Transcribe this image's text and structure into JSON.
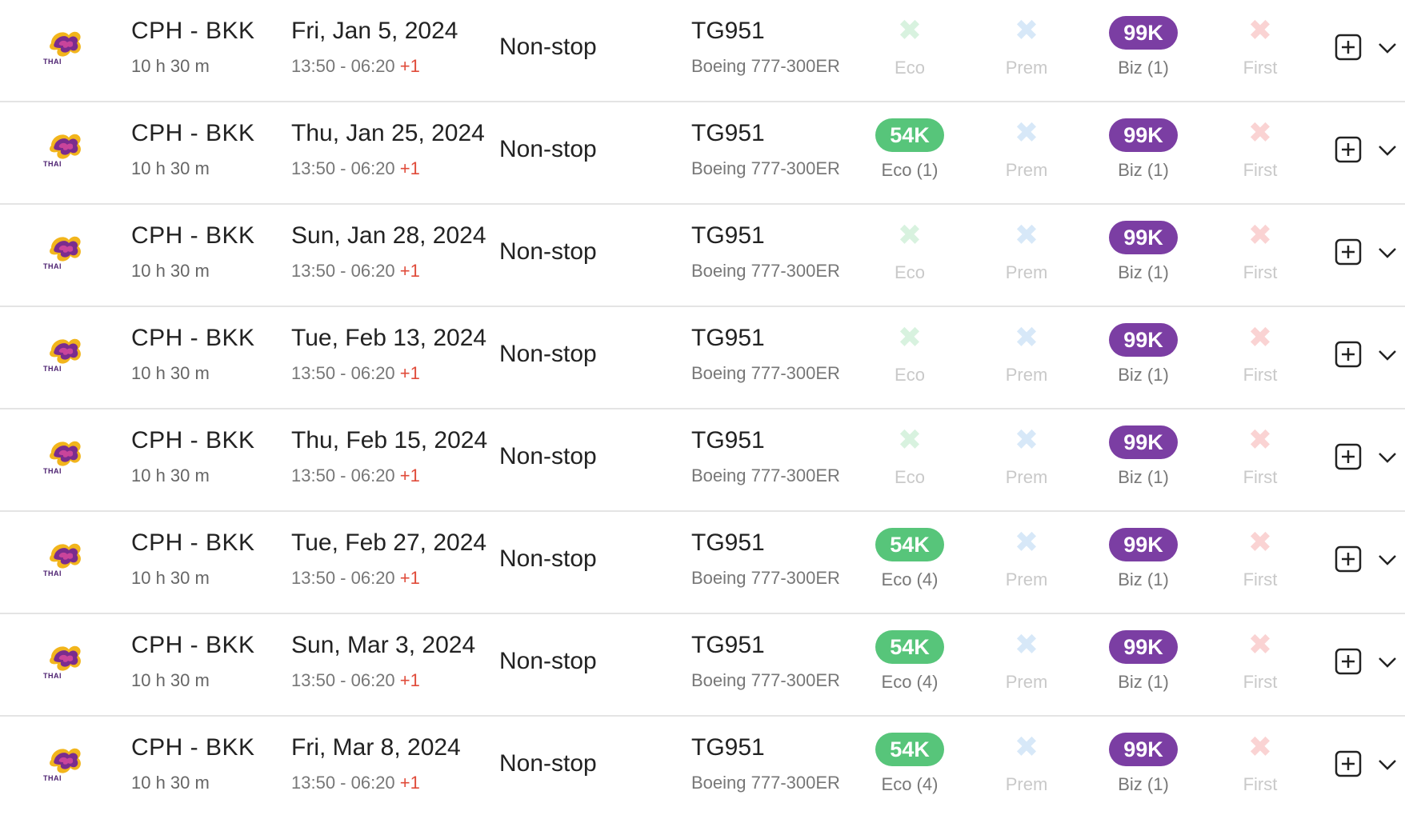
{
  "flights": [
    {
      "airline_logo_text": "THAI",
      "route": "CPH - BKK",
      "duration": "10 h 30 m",
      "date": "Fri, Jan 5, 2024",
      "times": "13:50 - 06:20",
      "day_offset": "+1",
      "stops": "Non-stop",
      "flight_number": "TG951",
      "aircraft": "Boeing 777-300ER",
      "fares": {
        "eco": {
          "available": false,
          "price": "",
          "label": "Eco"
        },
        "prem": {
          "available": false,
          "price": "",
          "label": "Prem"
        },
        "biz": {
          "available": true,
          "price": "99K",
          "label": "Biz (1)"
        },
        "first": {
          "available": false,
          "price": "",
          "label": "First"
        }
      }
    },
    {
      "airline_logo_text": "THAI",
      "route": "CPH - BKK",
      "duration": "10 h 30 m",
      "date": "Thu, Jan 25, 2024",
      "times": "13:50 - 06:20",
      "day_offset": "+1",
      "stops": "Non-stop",
      "flight_number": "TG951",
      "aircraft": "Boeing 777-300ER",
      "fares": {
        "eco": {
          "available": true,
          "price": "54K",
          "label": "Eco (1)"
        },
        "prem": {
          "available": false,
          "price": "",
          "label": "Prem"
        },
        "biz": {
          "available": true,
          "price": "99K",
          "label": "Biz (1)"
        },
        "first": {
          "available": false,
          "price": "",
          "label": "First"
        }
      }
    },
    {
      "airline_logo_text": "THAI",
      "route": "CPH - BKK",
      "duration": "10 h 30 m",
      "date": "Sun, Jan 28, 2024",
      "times": "13:50 - 06:20",
      "day_offset": "+1",
      "stops": "Non-stop",
      "flight_number": "TG951",
      "aircraft": "Boeing 777-300ER",
      "fares": {
        "eco": {
          "available": false,
          "price": "",
          "label": "Eco"
        },
        "prem": {
          "available": false,
          "price": "",
          "label": "Prem"
        },
        "biz": {
          "available": true,
          "price": "99K",
          "label": "Biz (1)"
        },
        "first": {
          "available": false,
          "price": "",
          "label": "First"
        }
      }
    },
    {
      "airline_logo_text": "THAI",
      "route": "CPH - BKK",
      "duration": "10 h 30 m",
      "date": "Tue, Feb 13, 2024",
      "times": "13:50 - 06:20",
      "day_offset": "+1",
      "stops": "Non-stop",
      "flight_number": "TG951",
      "aircraft": "Boeing 777-300ER",
      "fares": {
        "eco": {
          "available": false,
          "price": "",
          "label": "Eco"
        },
        "prem": {
          "available": false,
          "price": "",
          "label": "Prem"
        },
        "biz": {
          "available": true,
          "price": "99K",
          "label": "Biz (1)"
        },
        "first": {
          "available": false,
          "price": "",
          "label": "First"
        }
      }
    },
    {
      "airline_logo_text": "THAI",
      "route": "CPH - BKK",
      "duration": "10 h 30 m",
      "date": "Thu, Feb 15, 2024",
      "times": "13:50 - 06:20",
      "day_offset": "+1",
      "stops": "Non-stop",
      "flight_number": "TG951",
      "aircraft": "Boeing 777-300ER",
      "fares": {
        "eco": {
          "available": false,
          "price": "",
          "label": "Eco"
        },
        "prem": {
          "available": false,
          "price": "",
          "label": "Prem"
        },
        "biz": {
          "available": true,
          "price": "99K",
          "label": "Biz (1)"
        },
        "first": {
          "available": false,
          "price": "",
          "label": "First"
        }
      }
    },
    {
      "airline_logo_text": "THAI",
      "route": "CPH - BKK",
      "duration": "10 h 30 m",
      "date": "Tue, Feb 27, 2024",
      "times": "13:50 - 06:20",
      "day_offset": "+1",
      "stops": "Non-stop",
      "flight_number": "TG951",
      "aircraft": "Boeing 777-300ER",
      "fares": {
        "eco": {
          "available": true,
          "price": "54K",
          "label": "Eco (4)"
        },
        "prem": {
          "available": false,
          "price": "",
          "label": "Prem"
        },
        "biz": {
          "available": true,
          "price": "99K",
          "label": "Biz (1)"
        },
        "first": {
          "available": false,
          "price": "",
          "label": "First"
        }
      }
    },
    {
      "airline_logo_text": "THAI",
      "route": "CPH - BKK",
      "duration": "10 h 30 m",
      "date": "Sun, Mar 3, 2024",
      "times": "13:50 - 06:20",
      "day_offset": "+1",
      "stops": "Non-stop",
      "flight_number": "TG951",
      "aircraft": "Boeing 777-300ER",
      "fares": {
        "eco": {
          "available": true,
          "price": "54K",
          "label": "Eco (4)"
        },
        "prem": {
          "available": false,
          "price": "",
          "label": "Prem"
        },
        "biz": {
          "available": true,
          "price": "99K",
          "label": "Biz (1)"
        },
        "first": {
          "available": false,
          "price": "",
          "label": "First"
        }
      }
    },
    {
      "airline_logo_text": "THAI",
      "route": "CPH - BKK",
      "duration": "10 h 30 m",
      "date": "Fri, Mar 8, 2024",
      "times": "13:50 - 06:20",
      "day_offset": "+1",
      "stops": "Non-stop",
      "flight_number": "TG951",
      "aircraft": "Boeing 777-300ER",
      "fares": {
        "eco": {
          "available": true,
          "price": "54K",
          "label": "Eco (4)"
        },
        "prem": {
          "available": false,
          "price": "",
          "label": "Prem"
        },
        "biz": {
          "available": true,
          "price": "99K",
          "label": "Biz (1)"
        },
        "first": {
          "available": false,
          "price": "",
          "label": "First"
        }
      }
    }
  ],
  "icons": {
    "unavailable": "close-icon",
    "add": "plus-square-icon",
    "expand": "chevron-down-icon",
    "airline": "thai-airways-logo-icon"
  },
  "colors": {
    "eco_available": "#57c57a",
    "biz_available": "#7b3ea3",
    "eco_unavailable": "#d8f2df",
    "prem_unavailable": "#d7e8f8",
    "first_unavailable": "#fad3d3",
    "day_offset": "#e04b3a"
  }
}
